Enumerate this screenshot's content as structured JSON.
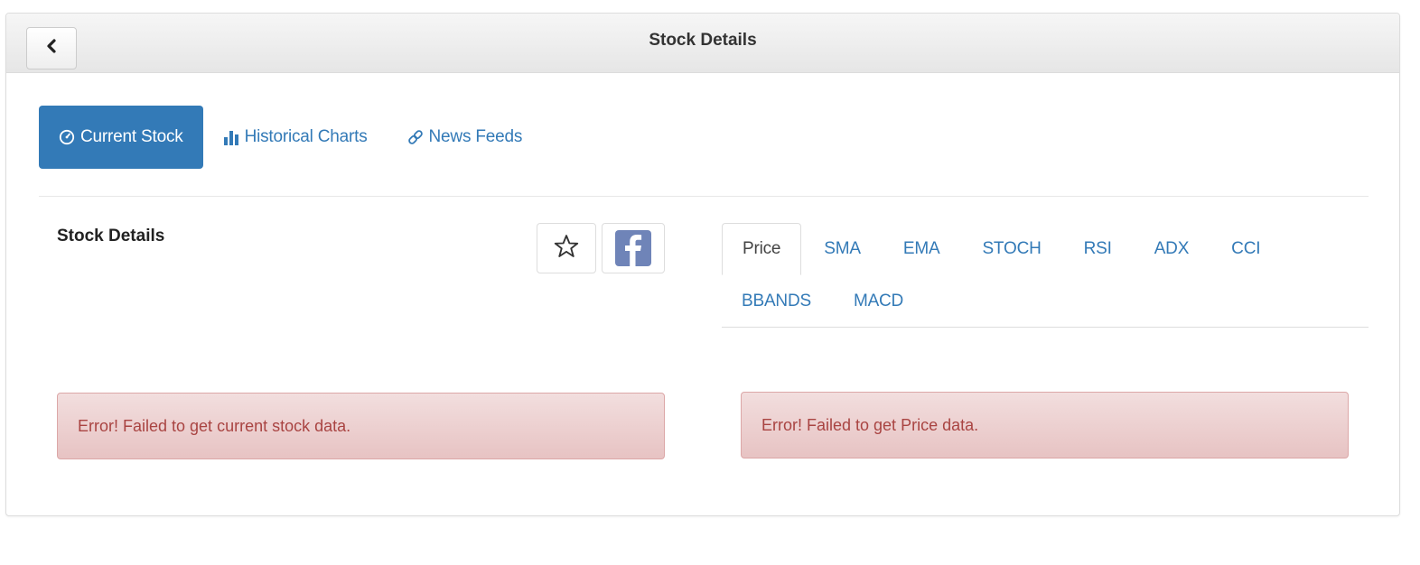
{
  "header": {
    "back_icon": "chevron-left-icon",
    "title": "Stock Details"
  },
  "nav": {
    "items": [
      {
        "label": "Current Stock",
        "icon": "dashboard-icon",
        "active": true
      },
      {
        "label": "Historical Charts",
        "icon": "bar-chart-icon",
        "active": false
      },
      {
        "label": "News Feeds",
        "icon": "link-icon",
        "active": false
      }
    ]
  },
  "details": {
    "title": "Stock Details",
    "favorite_icon": "star-outline-icon",
    "share_icon": "facebook-icon",
    "error": "Error! Failed to get current stock data."
  },
  "indicators": {
    "tabs": [
      "Price",
      "SMA",
      "EMA",
      "STOCH",
      "RSI",
      "ADX",
      "CCI",
      "BBANDS",
      "MACD"
    ],
    "active_tab": "Price",
    "error": "Error! Failed to get Price data."
  },
  "colors": {
    "primary": "#337ab7",
    "danger_text": "#a94442",
    "danger_bg": "#f2dede",
    "facebook": "#6f84b8"
  }
}
